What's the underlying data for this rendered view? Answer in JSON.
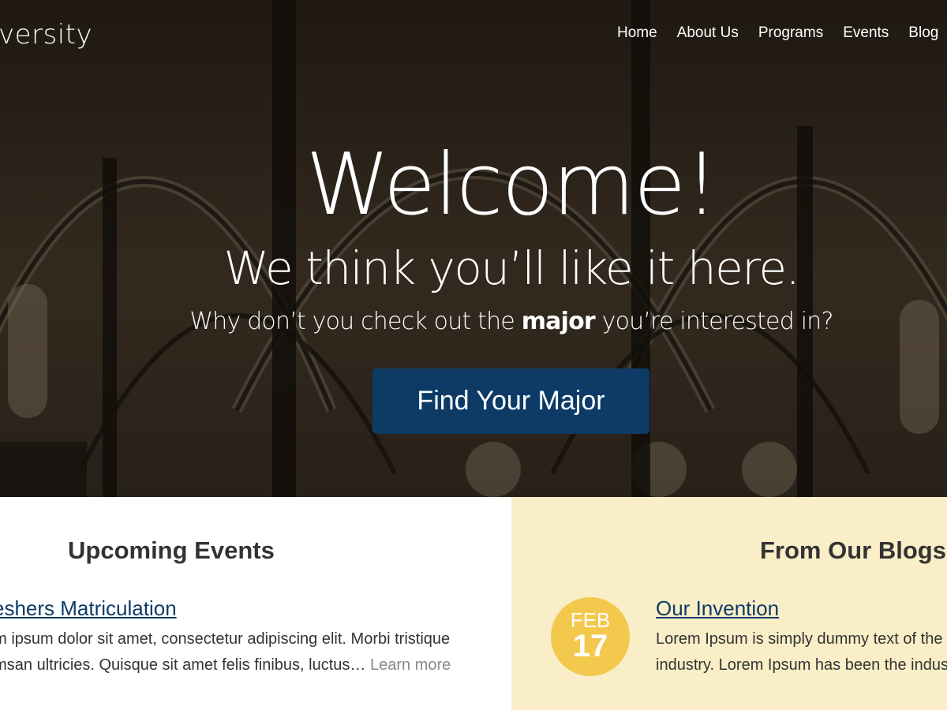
{
  "header": {
    "logo_text": "versity",
    "nav": [
      "Home",
      "About Us",
      "Programs",
      "Events",
      "Blog"
    ]
  },
  "hero": {
    "title": "Welcome!",
    "subtitle": "We think you’ll like it here.",
    "prompt_before": "Why don’t you check out the ",
    "prompt_bold": "major",
    "prompt_after": " you’re interested in?",
    "cta_label": "Find Your Major"
  },
  "events": {
    "title": "Upcoming Events",
    "item_title": "eshers Matriculation",
    "item_text_line1": "em ipsum dolor sit amet, consectetur adipiscing elit. Morbi tristique",
    "item_text_line2": "umsan ultricies. Quisque sit amet felis finibus, luctus…",
    "learn_more": "Learn more"
  },
  "blogs": {
    "title": "From Our Blogs",
    "date_month": "FEB",
    "date_day": "17",
    "item_title": "Our Invention",
    "item_text_line1": "Lorem Ipsum is simply dummy text of the",
    "item_text_line2": "industry. Lorem Ipsum has been the indus"
  },
  "colors": {
    "primary": "#0d3b66",
    "blog_bg": "#f9eec7",
    "badge": "#f3c94d"
  }
}
